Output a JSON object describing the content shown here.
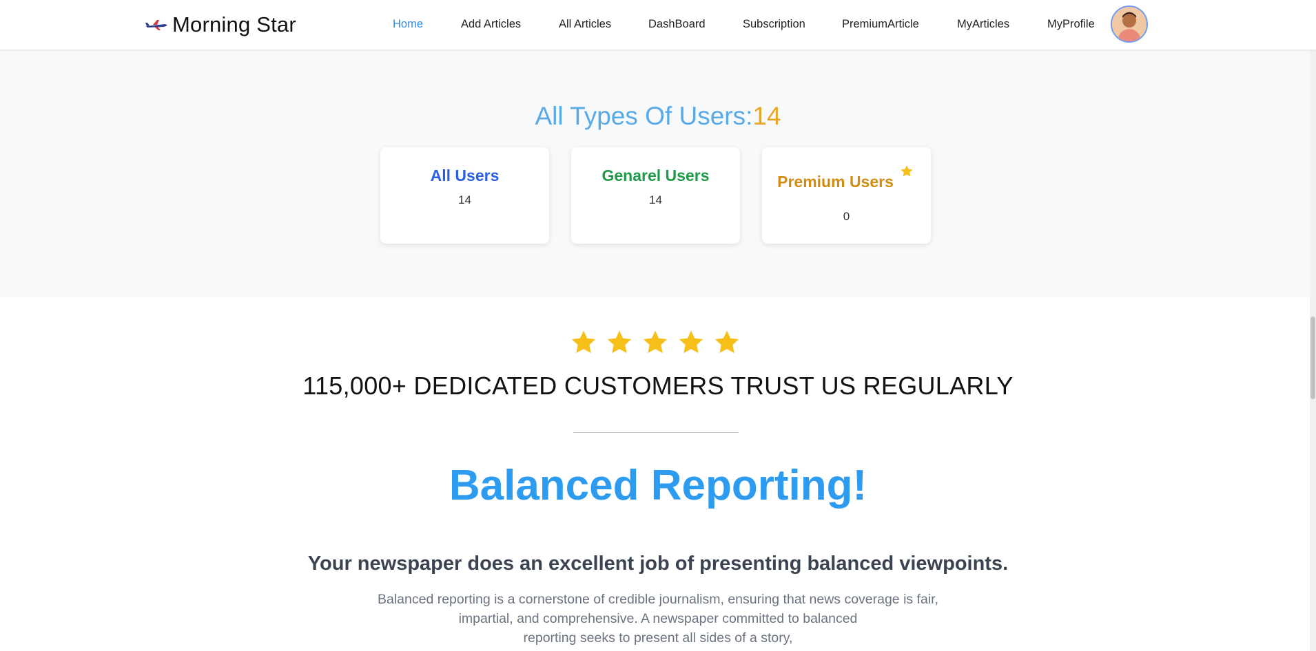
{
  "header": {
    "brand": "Morning Star",
    "nav": [
      {
        "label": "Home",
        "active": true
      },
      {
        "label": "Add Articles",
        "active": false
      },
      {
        "label": "All Articles",
        "active": false
      },
      {
        "label": "DashBoard",
        "active": false
      },
      {
        "label": "Subscription",
        "active": false
      },
      {
        "label": "PremiumArticle",
        "active": false
      },
      {
        "label": "MyArticles",
        "active": false
      },
      {
        "label": "MyProfile",
        "active": false
      }
    ]
  },
  "users": {
    "title": "All Types Of Users:",
    "total": "14",
    "cards": [
      {
        "label": "All Users",
        "value": "14",
        "color": "#2c5fe0"
      },
      {
        "label": "Genarel Users",
        "value": "14",
        "color": "#1f9a48"
      },
      {
        "label": "Premium Users",
        "value": "0",
        "color": "#d18c12"
      }
    ]
  },
  "trust": {
    "rating": 5,
    "text": "115,000+ DEDICATED CUSTOMERS TRUST US REGULARLY"
  },
  "feature": {
    "title": "Balanced Reporting!",
    "subtitle": "Your newspaper does an excellent job of presenting balanced viewpoints.",
    "lines": [
      "Balanced reporting is a cornerstone of credible journalism, ensuring that news coverage is fair,",
      "impartial, and comprehensive. A newspaper committed to balanced",
      "reporting seeks to present all sides of a story,"
    ]
  },
  "colors": {
    "accent": "#2f8be3",
    "star": "#f6bf1a",
    "title_blue": "#5aaae6",
    "count_gold": "#e8a628"
  }
}
